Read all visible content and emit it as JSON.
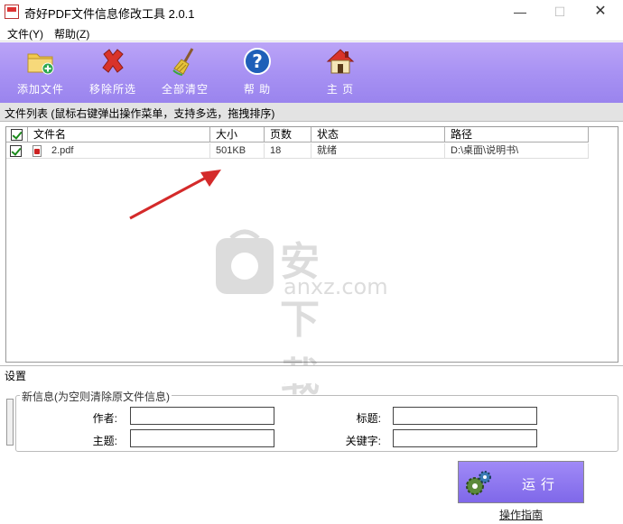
{
  "window": {
    "title": "奇好PDF文件信息修改工具 2.0.1",
    "minimize": "—",
    "maximize": "☐",
    "close": "✕"
  },
  "menu": [
    {
      "label": "文件(Y)"
    },
    {
      "label": "帮助(Z)"
    }
  ],
  "toolbar": {
    "add_files": "添加文件",
    "remove_selected": "移除所选",
    "clear_all": "全部清空",
    "help": "帮 助",
    "home": "主 页"
  },
  "file_list": {
    "title": "文件列表  (鼠标右键弹出操作菜单，支持多选，拖拽排序)",
    "columns": {
      "name": "文件名",
      "size": "大小",
      "pages": "页数",
      "status": "状态",
      "path": "路径"
    },
    "rows": [
      {
        "checked": true,
        "name": "2.pdf",
        "size": "501KB",
        "pages": "18",
        "status": "就绪",
        "path": "D:\\桌面\\说明书\\"
      }
    ]
  },
  "watermark": {
    "text": "安下载",
    "sub": "anxz.com"
  },
  "settings": {
    "title": "设置",
    "group_title": "新信息(为空则清除原文件信息)",
    "author_label": "作者:",
    "title_label": "标题:",
    "subject_label": "主题:",
    "keywords_label": "关键字:",
    "author_value": "",
    "title_value": "",
    "subject_value": "",
    "keywords_value": ""
  },
  "actions": {
    "run": "运行",
    "guide": "操作指南"
  },
  "colors": {
    "toolbar": "#a892f3",
    "run_button": "#8f78ef",
    "check": "#1a8a1a",
    "arrow": "#d42a2a"
  }
}
